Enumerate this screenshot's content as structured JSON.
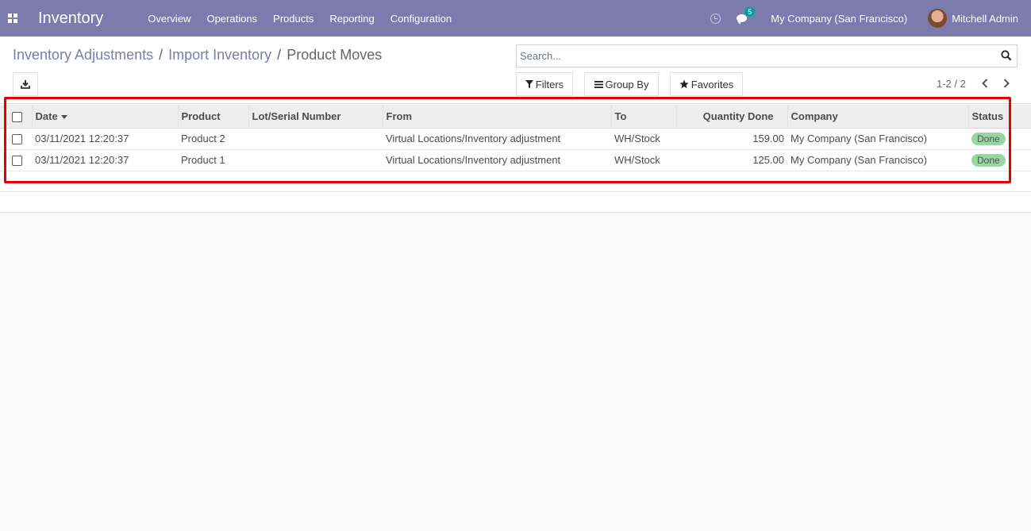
{
  "navbar": {
    "brand": "Inventory",
    "menu": [
      "Overview",
      "Operations",
      "Products",
      "Reporting",
      "Configuration"
    ],
    "messages_count": "5",
    "company": "My Company (San Francisco)",
    "user": "Mitchell Admin",
    "color": "#7c7bad"
  },
  "breadcrumb": {
    "items": [
      "Inventory Adjustments",
      "Import Inventory"
    ],
    "separator": "/",
    "current": "Product Moves"
  },
  "search": {
    "placeholder": "Search...",
    "value": ""
  },
  "buttons": {
    "filters": "Filters",
    "group_by": "Group By",
    "favorites": "Favorites"
  },
  "pager": "1-2 / 2",
  "table": {
    "columns": [
      "Date",
      "Product",
      "Lot/Serial Number",
      "From",
      "To",
      "Quantity Done",
      "Company",
      "Status"
    ],
    "rows": [
      {
        "date": "03/11/2021 12:20:37",
        "product": "Product 2",
        "lot": "",
        "from": "Virtual Locations/Inventory adjustment",
        "to": "WH/Stock",
        "qty": "159.00",
        "company": "My Company (San Francisco)",
        "status": "Done"
      },
      {
        "date": "03/11/2021 12:20:37",
        "product": "Product 1",
        "lot": "",
        "from": "Virtual Locations/Inventory adjustment",
        "to": "WH/Stock",
        "qty": "125.00",
        "company": "My Company (San Francisco)",
        "status": "Done"
      }
    ]
  },
  "colors": {
    "highlight": "#e30000",
    "status_done": "#99d5a5"
  }
}
